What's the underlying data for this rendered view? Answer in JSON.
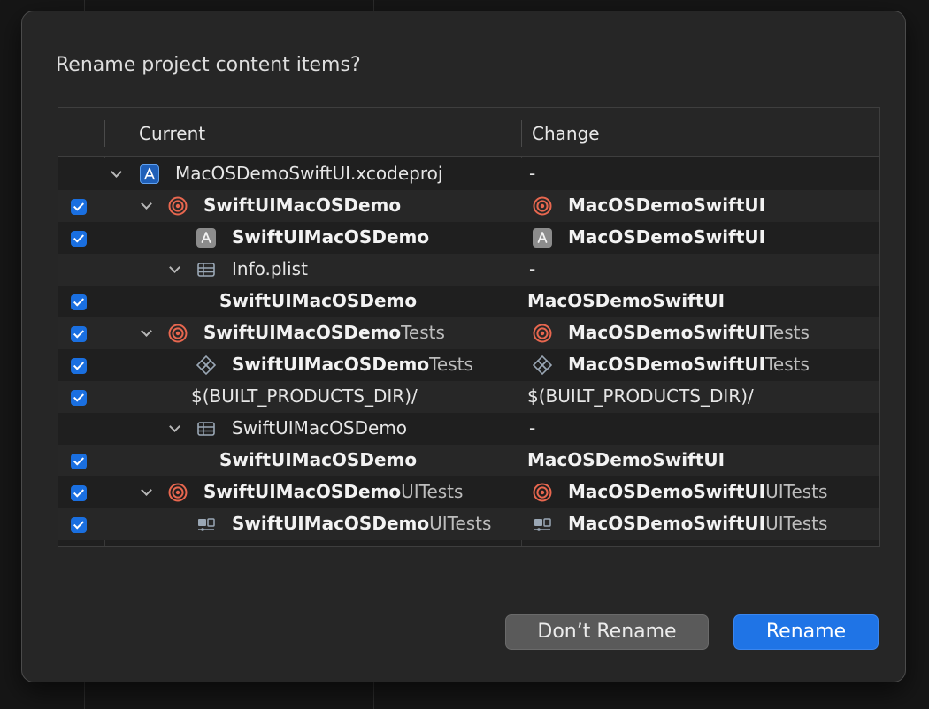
{
  "dialog": {
    "title": "Rename project content items?",
    "columns": {
      "current": "Current",
      "change": "Change"
    },
    "rows": [
      {
        "checked": false,
        "disclosure": true,
        "icon": "xcodeproj-icon",
        "current": {
          "bold": "",
          "normal": "MacOSDemoSwiftUI.xcodeproj",
          "dim": ""
        },
        "change": {
          "dash": "-"
        }
      },
      {
        "checked": true,
        "disclosure": true,
        "icon": "target-icon",
        "current": {
          "bold": "SwiftUIMacOSDemo",
          "normal": "",
          "dim": ""
        },
        "change": {
          "icon": "target-icon",
          "bold": "MacOSDemoSwiftUI",
          "dim": ""
        }
      },
      {
        "checked": true,
        "disclosure": false,
        "icon": "app-icon",
        "current": {
          "bold": "SwiftUIMacOSDemo",
          "normal": "",
          "dim": ""
        },
        "change": {
          "icon": "app-icon",
          "bold": "MacOSDemoSwiftUI",
          "dim": ""
        }
      },
      {
        "checked": false,
        "disclosure": true,
        "icon": "plist-icon",
        "current": {
          "bold": "",
          "normal": "Info.plist",
          "dim": ""
        },
        "change": {
          "dash": "-"
        }
      },
      {
        "checked": true,
        "disclosure": false,
        "icon": "",
        "current": {
          "bold": "SwiftUIMacOSDemo",
          "normal": "",
          "dim": ""
        },
        "change": {
          "bold": "MacOSDemoSwiftUI",
          "dim": ""
        }
      },
      {
        "checked": true,
        "disclosure": true,
        "icon": "target-icon",
        "current": {
          "bold": "SwiftUIMacOSDemo",
          "normal": "",
          "dim": "Tests"
        },
        "change": {
          "icon": "target-icon",
          "bold": "MacOSDemoSwiftUI",
          "dim": "Tests"
        }
      },
      {
        "checked": true,
        "disclosure": false,
        "icon": "unit-test-icon",
        "current": {
          "bold": "SwiftUIMacOSDemo",
          "normal": "",
          "dim": "Tests"
        },
        "change": {
          "icon": "unit-test-icon",
          "bold": "MacOSDemoSwiftUI",
          "dim": "Tests"
        }
      },
      {
        "checked": true,
        "disclosure": false,
        "icon": "",
        "current": {
          "bold": "",
          "normal": "$(BUILT_PRODUCTS_DIR)/",
          "dim": ""
        },
        "change": {
          "normal": "$(BUILT_PRODUCTS_DIR)/"
        }
      },
      {
        "checked": false,
        "disclosure": true,
        "icon": "plist-icon",
        "current": {
          "bold": "",
          "normal": "SwiftUIMacOSDemo",
          "dim": ""
        },
        "change": {
          "dash": "-"
        }
      },
      {
        "checked": true,
        "disclosure": false,
        "icon": "",
        "current": {
          "bold": "SwiftUIMacOSDemo",
          "normal": "",
          "dim": ""
        },
        "change": {
          "bold": "MacOSDemoSwiftUI",
          "dim": ""
        }
      },
      {
        "checked": true,
        "disclosure": true,
        "icon": "target-icon",
        "current": {
          "bold": "SwiftUIMacOSDemo",
          "normal": "",
          "dim": "UITests"
        },
        "change": {
          "icon": "target-icon",
          "bold": "MacOSDemoSwiftUI",
          "dim": "UITests"
        }
      },
      {
        "checked": true,
        "disclosure": false,
        "icon": "ui-test-icon",
        "current": {
          "bold": "SwiftUIMacOSDemo",
          "normal": "",
          "dim": "UITests"
        },
        "change": {
          "icon": "ui-test-icon",
          "bold": "MacOSDemoSwiftUI",
          "dim": "UITests"
        }
      }
    ],
    "buttons": {
      "dont_rename": "Don’t Rename",
      "rename": "Rename"
    }
  },
  "colors": {
    "accent": "#1f74e6",
    "target_red": "#e8674f",
    "dialog_bg": "#262626"
  }
}
